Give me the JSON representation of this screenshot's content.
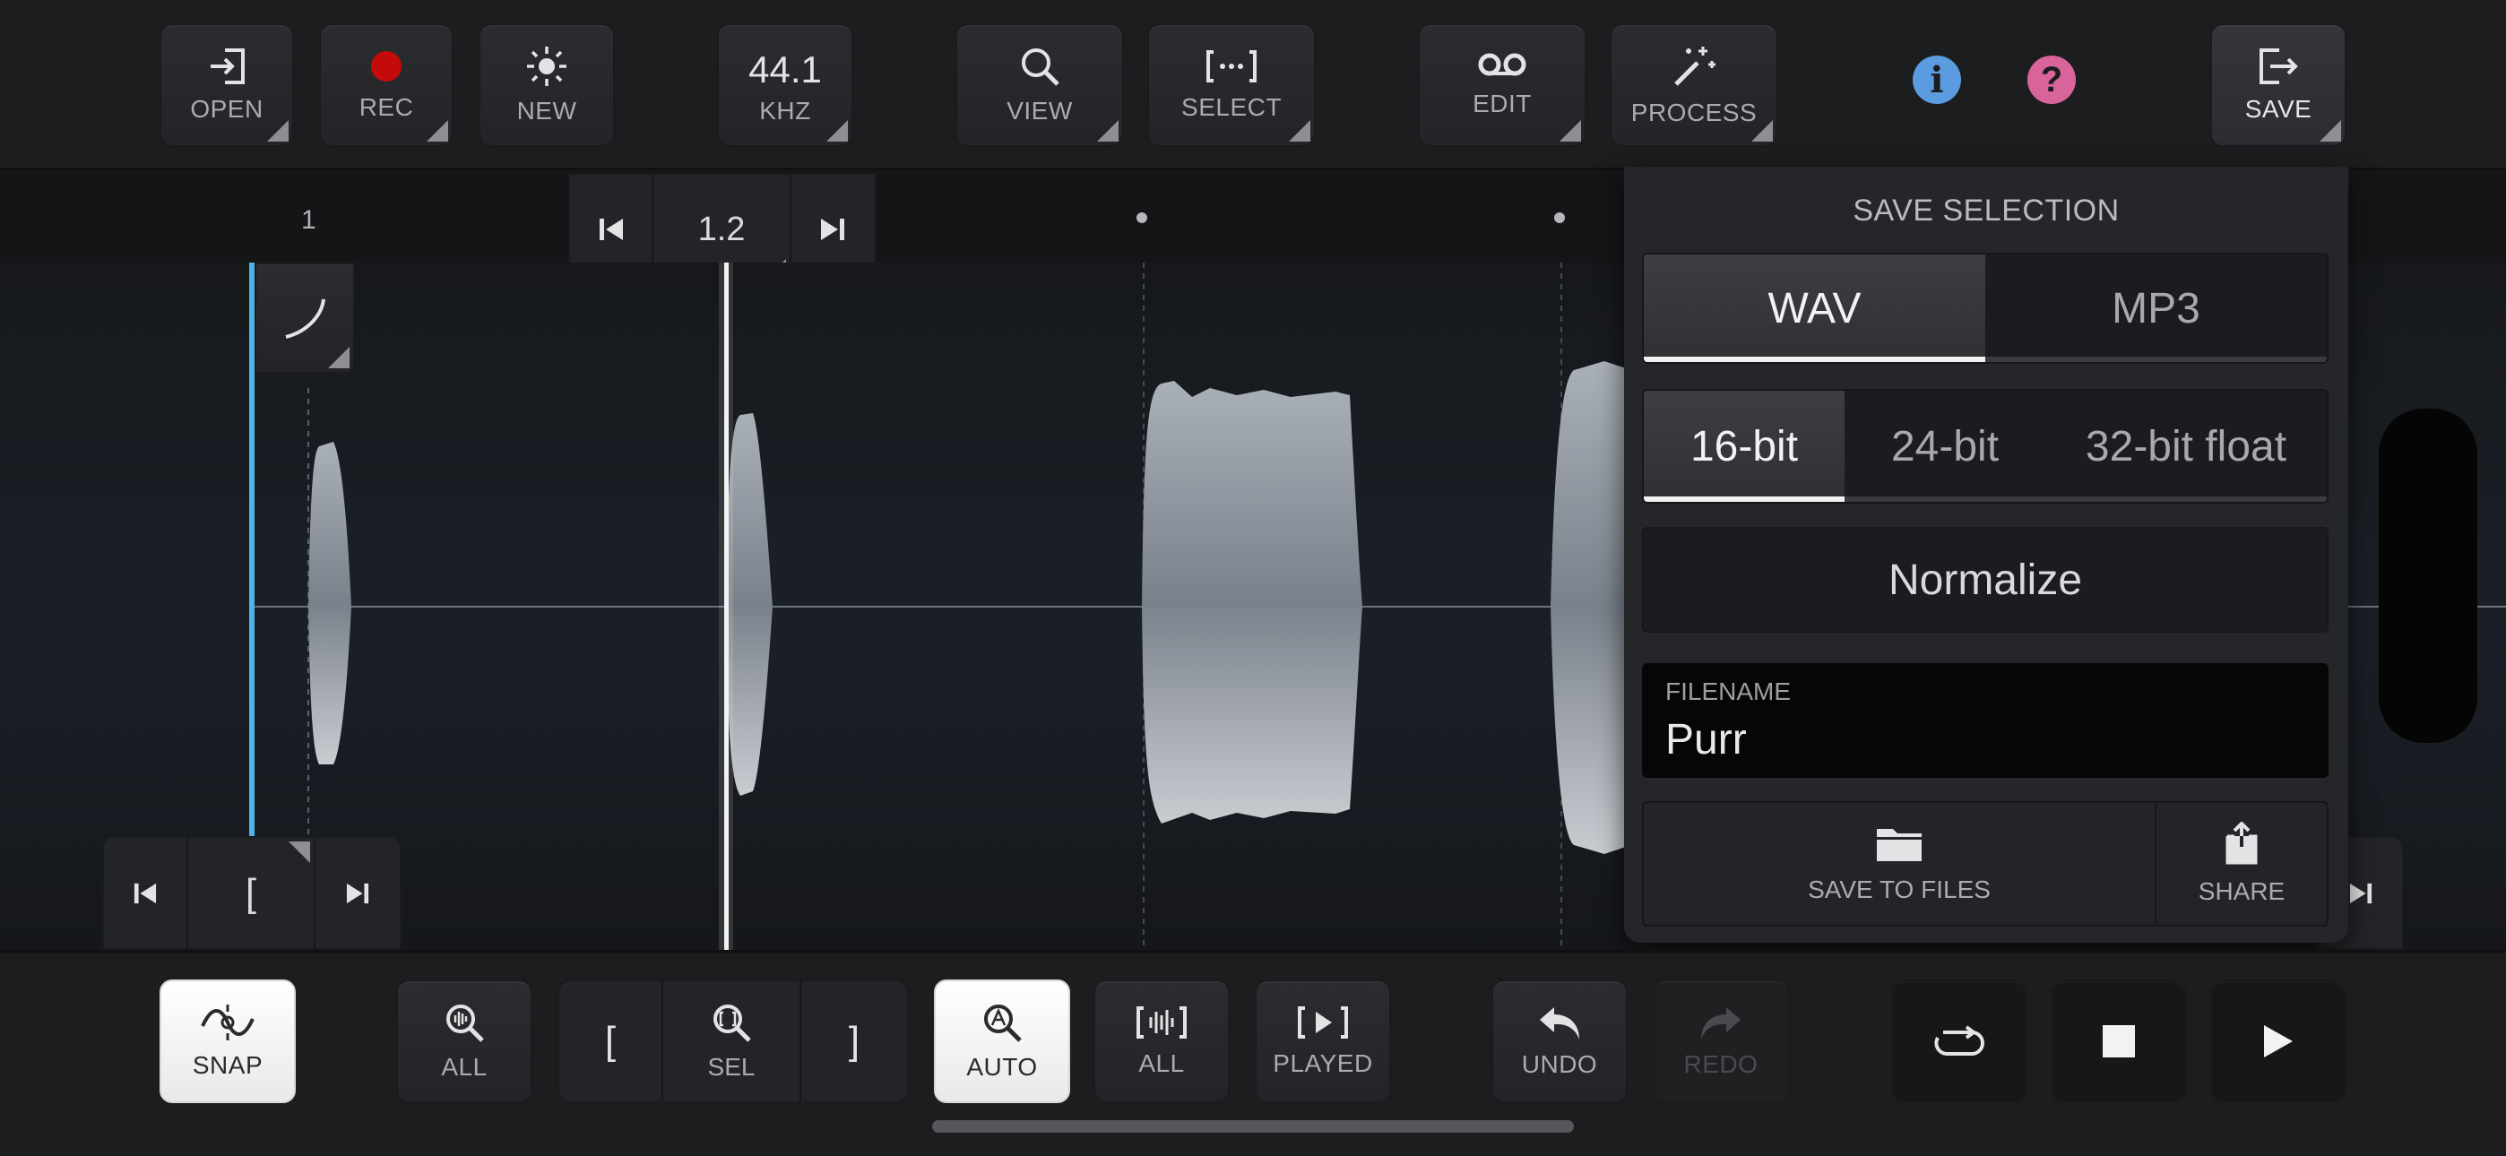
{
  "top_bar": {
    "open_label": "OPEN",
    "rec_label": "REC",
    "new_label": "NEW",
    "rate_value": "44.1",
    "rate_unit": "KHZ",
    "view_label": "VIEW",
    "select_label": "SELECT",
    "edit_label": "EDIT",
    "process_label": "PROCESS",
    "save_label": "SAVE",
    "info_glyph": "i",
    "help_glyph": "?"
  },
  "ruler": {
    "marker_label": "1"
  },
  "position_nav": {
    "value": "1.2"
  },
  "selection_nav": {
    "bracket": "["
  },
  "save_panel": {
    "title": "SAVE SELECTION",
    "formats": [
      "WAV",
      "MP3"
    ],
    "selected_format": "WAV",
    "bit_depths": [
      "16-bit",
      "24-bit",
      "32-bit float"
    ],
    "selected_bit_depth": "16-bit",
    "normalize_label": "Normalize",
    "filename_label": "FILENAME",
    "filename_value": "Purr",
    "save_to_files_label": "SAVE TO FILES",
    "share_label": "SHARE"
  },
  "bottom_bar": {
    "snap_label": "SNAP",
    "zoom_all_label": "ALL",
    "sel_left": "[",
    "sel_label": "SEL",
    "sel_right": "]",
    "auto_label": "AUTO",
    "all_label": "ALL",
    "played_label": "PLAYED",
    "undo_label": "UNDO",
    "redo_label": "REDO"
  },
  "colors": {
    "accent_blue": "#4fb3e8",
    "rec_red": "#c40a0a",
    "info_blue": "#5b9be0",
    "help_pink": "#d9649c"
  }
}
